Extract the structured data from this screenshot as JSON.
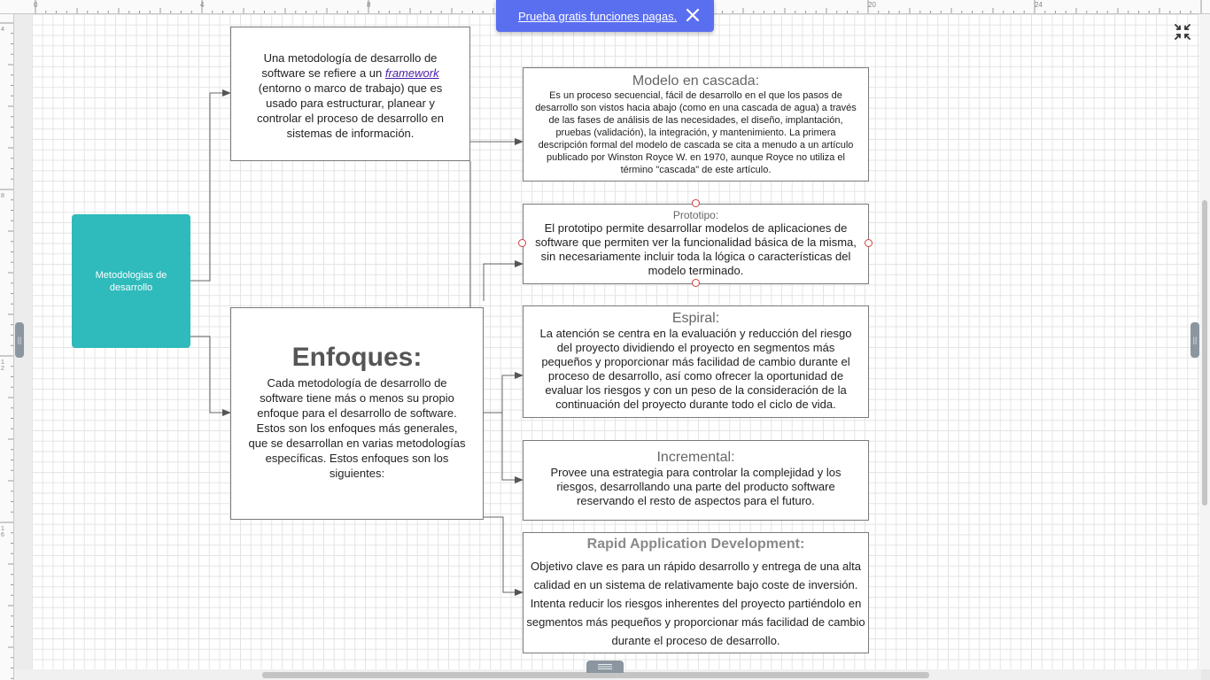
{
  "banner": {
    "link_text": "Prueba gratis funciones pagas."
  },
  "ruler": {
    "top_labels": [
      "0",
      "4",
      "8",
      "20",
      "24"
    ],
    "left_labels": [
      "4",
      "8",
      "1\n2",
      "1\n6"
    ]
  },
  "diagram": {
    "root_label": "Metodologias de desarrollo",
    "intro": {
      "text_before": "Una metodología de desarrollo de software se refiere a un ",
      "link": "framework",
      "text_after": " (entorno o marco de trabajo) que es usado para estructurar, planear y controlar el proceso de desarrollo en sistemas de información."
    },
    "enfoques": {
      "title": "Enfoques:",
      "body": "Cada metodología de desarrollo de software tiene más o menos su propio enfoque para el desarrollo de software. Estos son los enfoques más generales, que se desarrollan en varias metodologías específicas. Estos enfoques son los siguientes:"
    },
    "cascada": {
      "title": "Modelo en cascada:",
      "body": "Es un proceso secuencial, fácil de desarrollo en el que los pasos de desarrollo son vistos hacia abajo (como en una cascada de agua) a través de las fases de análisis de las necesidades, el diseño, implantación, pruebas (validación), la integración, y mantenimiento. La primera descripción formal del modelo de cascada se cita a menudo a un artículo publicado por Winston Royce W.  en 1970, aunque Royce no utiliza el término \"cascada\" de este artículo."
    },
    "prototipo": {
      "title": "Prototipo:",
      "body": "El prototipo permite desarrollar modelos de aplicaciones de software que permiten ver la funcionalidad básica de la misma, sin necesariamente incluir toda la lógica o características del modelo terminado."
    },
    "espiral": {
      "title": "Espiral:",
      "body": "La atención se centra en la evaluación y reducción del riesgo del proyecto dividiendo el proyecto en segmentos más pequeños y proporcionar más facilidad de cambio durante el proceso de desarrollo, así como ofrecer la oportunidad de evaluar los riesgos y con un peso de la consideración de la continuación del proyecto durante todo el ciclo de vida."
    },
    "incremental": {
      "title": "Incremental:",
      "body": "Provee una estrategia para controlar la complejidad y los riesgos, desarrollando una parte del producto software reservando el resto de aspectos para el futuro."
    },
    "rad": {
      "title": "Rapid Application Development:",
      "body": "Objetivo clave es para un rápido desarrollo y entrega de una alta calidad en un sistema de relativamente bajo coste de inversión. Intenta reducir los riesgos inherentes del proyecto partiéndolo en segmentos más pequeños y proporcionar más facilidad de cambio durante el proceso de desarrollo."
    }
  },
  "icons": {
    "close": "close-icon",
    "collapse": "collapse-fullscreen-icon",
    "handle": "grip-icon"
  },
  "colors": {
    "banner": "#5a6ff0",
    "root_node": "#2fbabb",
    "selection_handle": "#d04040"
  }
}
